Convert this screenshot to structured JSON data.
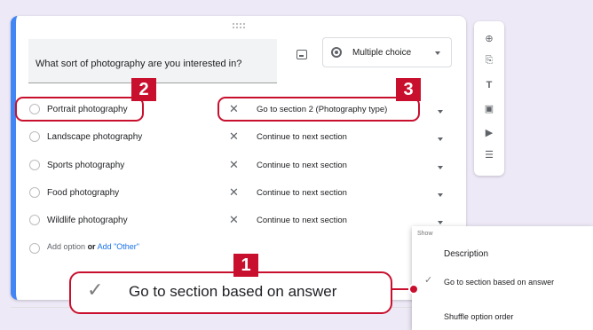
{
  "question": {
    "text": "What sort of photography are you interested in?",
    "type_selector": "Multiple choice"
  },
  "options": [
    {
      "label": "Portrait photography",
      "route": "Go to section 2 (Photography type)"
    },
    {
      "label": "Landscape photography",
      "route": "Continue to next section"
    },
    {
      "label": "Sports photography",
      "route": "Continue to next section"
    },
    {
      "label": "Food photography",
      "route": "Continue to next section"
    },
    {
      "label": "Wildlife photography",
      "route": "Continue to next section"
    }
  ],
  "add_option": {
    "label": "Add option",
    "or": "or",
    "other": "Add \"Other\""
  },
  "badges": {
    "one": "1",
    "two": "2",
    "three": "3"
  },
  "callout": {
    "text": "Go to section based on answer"
  },
  "menu": {
    "header": "Show",
    "items": [
      {
        "label": "Description",
        "checked": false
      },
      {
        "label": "Go to section based on answer",
        "checked": true
      },
      {
        "label": "Shuffle option order",
        "checked": false
      }
    ]
  },
  "sidebar_icons": [
    "add-question-icon",
    "import-questions-icon",
    "add-title-icon",
    "add-image-icon",
    "add-video-icon",
    "add-section-icon"
  ],
  "colors": {
    "accent": "#4285f4",
    "highlight": "#c8102e",
    "background": "#eee9f6"
  }
}
